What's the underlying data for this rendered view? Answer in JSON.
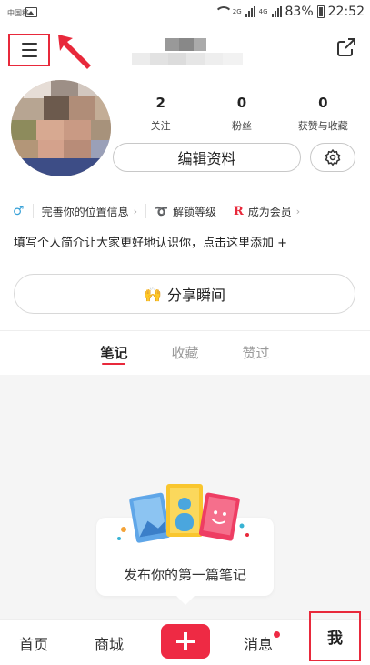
{
  "status_bar": {
    "carrier": "中国移",
    "net_2g": "2G",
    "net_4g": "4G",
    "battery": "83%",
    "time": "22:52"
  },
  "header": {
    "menu_icon": "menu-icon",
    "share_icon": "share-icon"
  },
  "profile": {
    "stats": [
      {
        "value": "2",
        "label": "关注"
      },
      {
        "value": "0",
        "label": "粉丝"
      },
      {
        "value": "0",
        "label": "获赞与收藏"
      }
    ],
    "edit_label": "编辑资料",
    "settings_icon": "gear-icon"
  },
  "tags": {
    "gender_symbol": "♂",
    "location": "完善你的位置信息",
    "level": "解锁等级",
    "vip_letter": "R",
    "vip": "成为会员",
    "chevron": "›"
  },
  "bio": "填写个人简介让大家更好地认识你，点击这里添加 +",
  "share_moment": {
    "icon": "🙌",
    "label": "分享瞬间"
  },
  "tabs": [
    "笔记",
    "收藏",
    "赞过"
  ],
  "empty_state": "发布你的第一篇笔记",
  "bottom_nav": {
    "home": "首页",
    "mall": "商城",
    "plus": "+",
    "messages": "消息",
    "me": "我"
  },
  "colors": {
    "accent": "#e8293b",
    "plus_button": "#ee2a44"
  }
}
